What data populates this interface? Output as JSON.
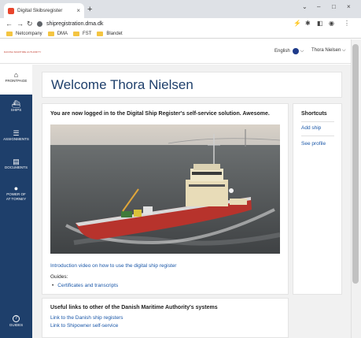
{
  "browser": {
    "tab_title": "Digital Skibsregister",
    "tab_close": "×",
    "new_tab": "+",
    "url": "shipregistration.dma.dk",
    "window_controls": [
      "⌄",
      "–",
      "□",
      "×"
    ],
    "bookmarks": [
      "Netcompany",
      "DMA",
      "FST",
      "Blandet"
    ]
  },
  "header": {
    "logo_text": "DANISH MARITIME AUTHORITY",
    "language": "English",
    "language_chevron": "⌵",
    "user": "Thora Nielsen ⌵"
  },
  "sidebar": {
    "items": [
      {
        "icon": "⌂",
        "label": "FRONTPAGE"
      },
      {
        "icon": "⛴",
        "label": "SHIPS"
      },
      {
        "icon": "☰",
        "label": "ASSIGNMENTS"
      },
      {
        "icon": "▤",
        "label": "DOCUMENTS"
      },
      {
        "icon": "●",
        "label": "POWER OF AT TORNEY"
      },
      {
        "icon": "?",
        "label": "GUIDES"
      }
    ]
  },
  "main": {
    "welcome": "Welcome Thora Nielsen",
    "intro": "You are now logged in to the Digital Ship Register's self-service solution. Awesome.",
    "video_link": "Introduction video on how to use the digital ship register",
    "guides_label": "Guides:",
    "guides_link": "Certificates and transcripts",
    "useful_links_heading": "Useful links to other of the Danish Maritime Authority's systems",
    "useful_links": [
      "Link to the Danish ship registers",
      "Link to Shipowner self-service"
    ]
  },
  "shortcuts": {
    "heading": "Shortcuts",
    "links": [
      "Add ship",
      "See profile"
    ]
  }
}
